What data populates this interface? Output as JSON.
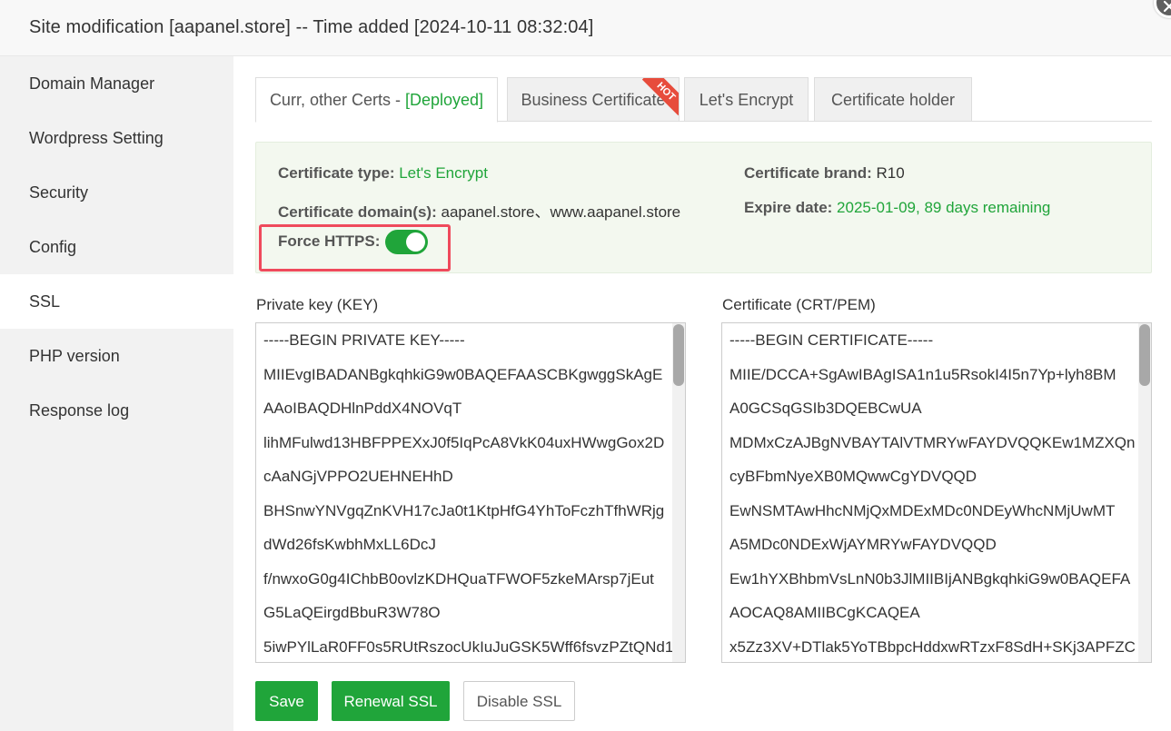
{
  "dialog": {
    "title": "Site modification [aapanel.store] -- Time added [2024-10-11 08:32:04]"
  },
  "sidebar": {
    "items": [
      {
        "label": "Domain Manager"
      },
      {
        "label": "Wordpress Setting"
      },
      {
        "label": "Security"
      },
      {
        "label": "Config"
      },
      {
        "label": "SSL"
      },
      {
        "label": "PHP version"
      },
      {
        "label": "Response log"
      }
    ],
    "active": "SSL"
  },
  "tabs": {
    "current": {
      "label": "Curr, other Certs - ",
      "status": "[Deployed]"
    },
    "business": {
      "label": "Business Certificate",
      "badge": "HOT"
    },
    "letsencrypt": {
      "label": "Let's Encrypt"
    },
    "holder": {
      "label": "Certificate holder"
    }
  },
  "cert": {
    "type_label": "Certificate type:",
    "type_value": "Let's Encrypt",
    "brand_label": "Certificate brand:",
    "brand_value": "R10",
    "domains_label": "Certificate domain(s):",
    "domains_value": "aapanel.store、www.aapanel.store",
    "expire_label": "Expire date:",
    "expire_value": "2025-01-09, 89 days remaining",
    "force_https_label": "Force HTTPS:",
    "force_https_on": true
  },
  "key": {
    "label": "Private key (KEY)",
    "lines": [
      "-----BEGIN PRIVATE KEY-----",
      "MIIEvgIBADANBgkqhkiG9w0BAQEFAASCBKgwggSkAgE",
      "AAoIBAQDHlnPddX4NOVqT",
      "lihMFulwd13HBFPPEXxJ0f5IqPcA8VkK04uxHWwgGox2D",
      "cAaNGjVPPO2UEHNEHhD",
      "BHSnwYNVgqZnKVH17cJa0t1KtpHfG4YhToFczhTfhWRjg",
      "dWd26fsKwbhMxLL6DcJ",
      "f/nwxoG0g4IChbB0ovlzKDHQuaTFWOF5zkeMArsp7jEut",
      "G5LaQEirgdBbuR3W78O",
      "5iwPYlLaR0FF0s5RUtRszocUkIuJuGSK5Wff6fsvzPZtQNd1"
    ]
  },
  "crt": {
    "label": "Certificate (CRT/PEM)",
    "lines": [
      "-----BEGIN CERTIFICATE-----",
      "MIIE/DCCA+SgAwIBAgISA1n1u5RsokI4I5n7Yp+lyh8BM",
      "A0GCSqGSIb3DQEBCwUA",
      "MDMxCzAJBgNVBAYTAlVTMRYwFAYDVQQKEw1MZXQn",
      "cyBFbmNyeXB0MQwwCgYDVQQD",
      "EwNSMTAwHhcNMjQxMDExMDc0NDEyWhcNMjUwMT",
      "A5MDc0NDExWjAYMRYwFAYDVQQD",
      "Ew1hYXBhbmVsLnN0b3JlMIIBIjANBgkqhkiG9w0BAQEFA",
      "AOCAQ8AMIIBCgKCAQEA",
      "x5Zz3XV+DTlak5YoTBbpcHddxwRTzxF8SdH+SKj3APFZC"
    ]
  },
  "actions": {
    "save": "Save",
    "renewal": "Renewal SSL",
    "disable": "Disable SSL"
  },
  "colors": {
    "accent": "#20a53a",
    "highlight": "#ef4a5c",
    "hot": "#e74c3c"
  }
}
